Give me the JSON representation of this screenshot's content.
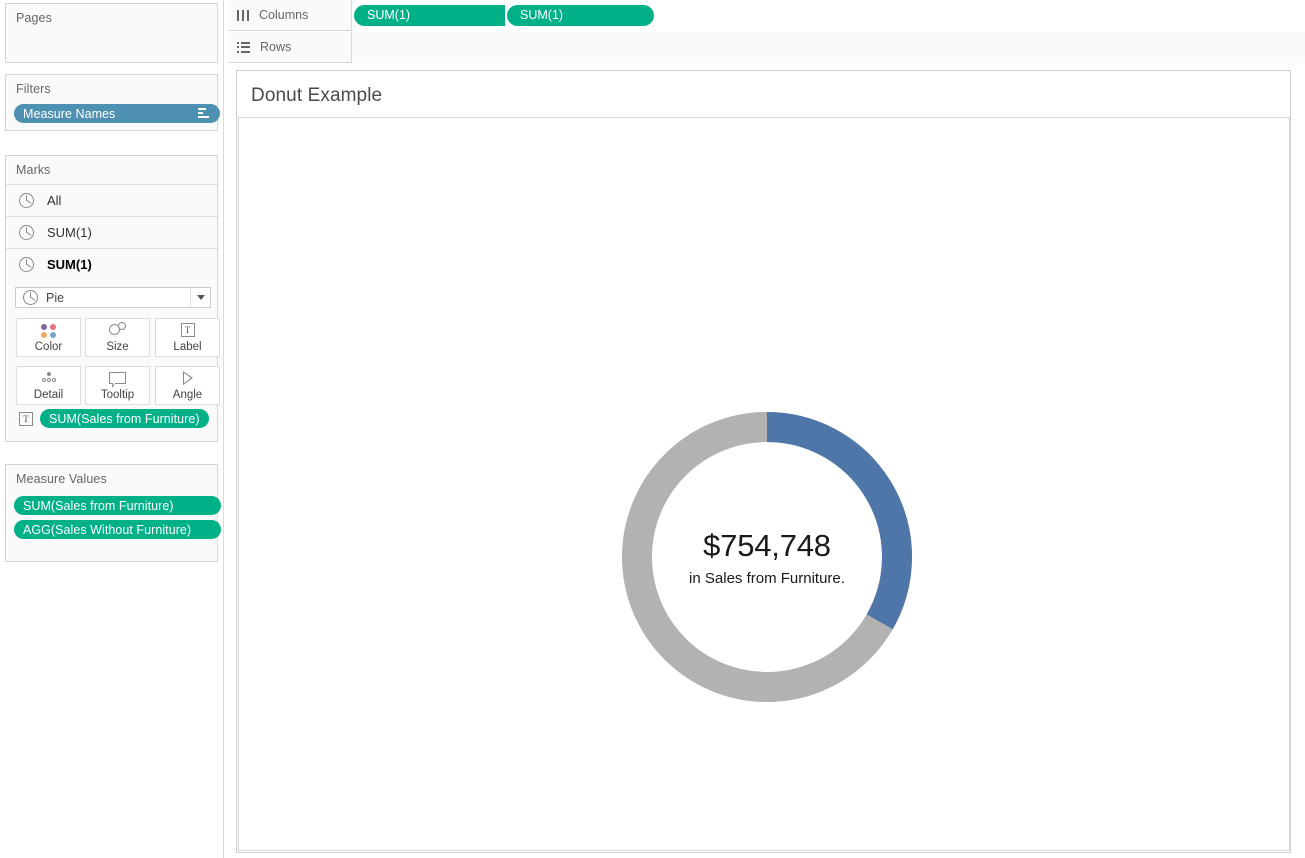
{
  "panels": {
    "pages": {
      "title": "Pages"
    },
    "filters": {
      "title": "Filters",
      "pill_label": "Measure Names",
      "pill_icon": "filter-lines-icon"
    },
    "marks": {
      "title": "Marks",
      "rows": [
        {
          "label": "All",
          "icon": "pie-mark-icon",
          "selected": false
        },
        {
          "label": "SUM(1)",
          "icon": "pie-mark-icon",
          "selected": false
        },
        {
          "label": "SUM(1)",
          "icon": "pie-mark-icon",
          "selected": true
        }
      ],
      "mark_type": {
        "value": "Pie",
        "icon": "pie-mark-icon",
        "caret": "chevron-down-icon"
      },
      "buttons": [
        {
          "label": "Color",
          "icon": "color-dots-icon"
        },
        {
          "label": "Size",
          "icon": "size-circles-icon"
        },
        {
          "label": "Label",
          "icon": "text-label-icon"
        },
        {
          "label": "Detail",
          "icon": "detail-dots-icon"
        },
        {
          "label": "Tooltip",
          "icon": "tooltip-bubble-icon"
        },
        {
          "label": "Angle",
          "icon": "angle-wedge-icon"
        }
      ],
      "label_pill": {
        "icon": "text-label-icon",
        "label": "SUM(Sales from Furniture)"
      }
    },
    "measure_values": {
      "title": "Measure Values",
      "pills": [
        "SUM(Sales from Furniture)",
        "AGG(Sales Without Furniture)"
      ]
    }
  },
  "shelves": {
    "columns": {
      "label": "Columns",
      "icon": "columns-icon",
      "pills": [
        "SUM(1)",
        "SUM(1)"
      ]
    },
    "rows": {
      "label": "Rows",
      "icon": "rows-icon",
      "pills": []
    }
  },
  "view": {
    "worksheet_title": "Donut Example",
    "donut": {
      "value_label": "$754,748",
      "caption": "in Sales from Furniture."
    }
  },
  "colors": {
    "pill_green": "#00b188",
    "pill_blue": "#4e90b1",
    "donut_blue": "#4e76a8",
    "donut_gray": "#b2b2b2",
    "panel_bg": "#fafafa",
    "border": "#d5d5d5"
  },
  "chart_data": {
    "type": "pie",
    "title": "Donut Example",
    "subtype": "donut",
    "center_value": "$754,748",
    "center_caption": "in Sales from Furniture.",
    "labels": [
      "Sales from Furniture",
      "Sales Without Furniture"
    ],
    "values": [
      33.3,
      66.7
    ],
    "colors": [
      "#4e76a8",
      "#b2b2b2"
    ],
    "start_angle_deg": 0,
    "unit": "percent of total sales",
    "legend": "none",
    "grid": false
  }
}
